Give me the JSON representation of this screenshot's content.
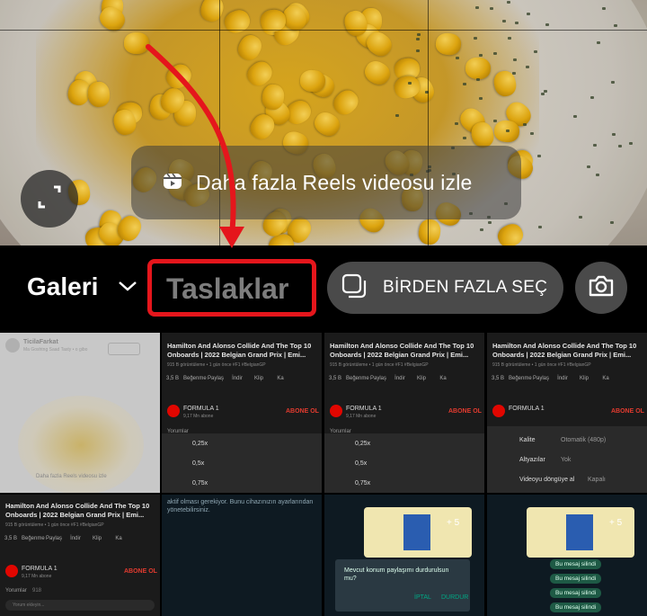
{
  "preview": {
    "reels_banner": "Daha fazla Reels videosu izle"
  },
  "toolbar": {
    "gallery_label": "Galeri",
    "drafts_label": "Taslaklar",
    "multi_select_label": "BİRDEN FAZLA SEÇ"
  },
  "colors": {
    "highlight_red": "#e5161c",
    "button_gray": "#4a4a4a",
    "drafts_text": "#7d7d7d"
  },
  "thumbnails": {
    "t1": {
      "user": "TicilaFarkat",
      "sub": "Ma Goshtng Saad Tasty • o gibo",
      "caption": "Daha fazla Reels videosu izle"
    },
    "video": {
      "title": "Hamilton And Alonso Collide And The Top 10 Onboards | 2022 Belgian Grand Prix | Emi...",
      "meta": "915 B görüntüleme • 1 gün önce #F1 #BelgianGP",
      "likes": "3,5 B",
      "dislike": "Beğenme",
      "share": "Paylaş",
      "remix": "İndir",
      "clip": "Klip",
      "save": "Ka",
      "channel": "FORMULA 1",
      "subs": "9,17 Mn abone",
      "subscribe": "ABONE OL",
      "comments": "Yorumlar",
      "comment_count": "918",
      "speed1": "0,25x",
      "speed2": "0,5x",
      "speed3": "0,75x",
      "quality_label": "Kalite",
      "quality_value": "Otomatik (480p)",
      "captions_label": "Altyazılar",
      "captions_value": "Yok",
      "loop_label": "Videoyu döngüye al",
      "loop_value": "Kapalı",
      "comment_placeholder": "Yorum ekleyin..."
    },
    "chat": {
      "text1": "aktif olması gerekiyor. Bunu cihazınızın ayarlarından yönetebilirsiniz.",
      "dialog_text": "Mevcut konum paylaşımı durdurulsun mu?",
      "dialog_cancel": "İPTAL",
      "dialog_ok": "DURDUR",
      "bubble": "Bu mesaj silindi",
      "time": "15:45",
      "plus": "+ 5"
    }
  }
}
